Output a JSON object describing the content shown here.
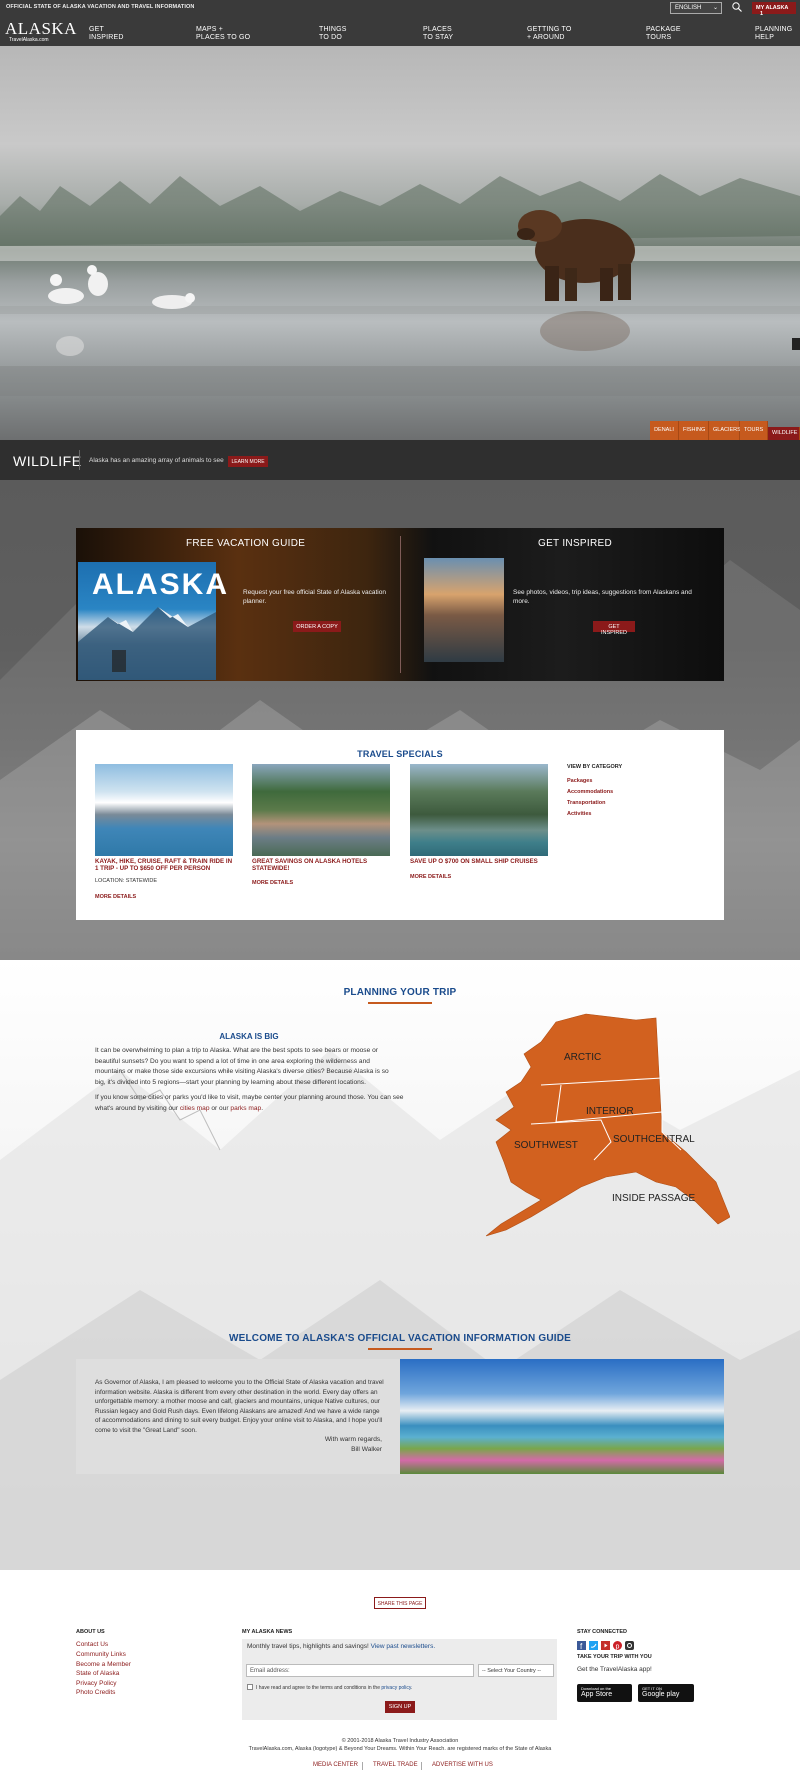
{
  "header": {
    "official_text": "OFFICIAL STATE OF ALASKA VACATION AND TRAVEL INFORMATION",
    "language": "ENGLISH",
    "my_alaska": "MY ALASKA",
    "my_alaska_count": "1",
    "logo_main": "ALASKA",
    "logo_sub": "TravelAlaska.com",
    "nav": [
      {
        "line1": "GET",
        "line2": "INSPIRED"
      },
      {
        "line1": "MAPS +",
        "line2": "PLACES TO GO"
      },
      {
        "line1": "THINGS",
        "line2": "TO DO"
      },
      {
        "line1": "PLACES",
        "line2": "TO STAY"
      },
      {
        "line1": "GETTING TO",
        "line2": "+ AROUND"
      },
      {
        "line1": "PACKAGE",
        "line2": "TOURS"
      },
      {
        "line1": "PLANNING",
        "line2": "HELP"
      }
    ]
  },
  "hero": {
    "tabs": [
      "DENALI",
      "FISHING",
      "GLACIERS",
      "TOURS",
      "WILDLIFE"
    ],
    "active_tab": "WILDLIFE",
    "caption_title": "WILDLIFE",
    "caption_text": "Alaska has an amazing array of animals to see",
    "learn_more": "LEARN MORE"
  },
  "promo": {
    "guide_title": "FREE VACATION GUIDE",
    "guide_cover_title": "ALASKA",
    "guide_text": "Request your free official State of Alaska vacation planner.",
    "guide_button": "ORDER A COPY",
    "inspire_title": "GET INSPIRED",
    "inspire_text": "See photos, videos, trip ideas, suggestions from Alaskans and more.",
    "inspire_button": "GET INSPIRED"
  },
  "specials": {
    "title": "TRAVEL SPECIALS",
    "items": [
      {
        "name": "KAYAK, HIKE, CRUISE, RAFT & TRAIN RIDE IN 1 TRIP - UP TO $650 OFF PER PERSON",
        "location": "LOCATION: STATEWIDE",
        "more": "MORE DETAILS"
      },
      {
        "name": "GREAT SAVINGS ON ALASKA HOTELS STATEWIDE!",
        "location": "",
        "more": "MORE DETAILS"
      },
      {
        "name": "SAVE UP O $700 ON SMALL SHIP CRUISES",
        "location": "",
        "more": "MORE DETAILS"
      }
    ],
    "category_head": "VIEW BY CATEGORY",
    "categories": [
      "Packages",
      "Accommodations",
      "Transportation",
      "Activities"
    ]
  },
  "planning": {
    "title": "PLANNING YOUR TRIP",
    "big_title": "ALASKA IS BIG",
    "para1": "It can be overwhelming to plan a trip to Alaska. What are the best spots to see bears or moose or beautiful sunsets? Do you want to spend a lot of time in one area exploring the wilderness and mountains or make those side excursions while visiting Alaska's diverse cities? Because Alaska is so big, it's divided into 5 regions—start your planning by learning about these different locations.",
    "para2_a": "If you know some cities or parks you'd like to visit, maybe center your planning around those. You can see what's around by visiting our ",
    "cities_map": "cities map",
    "para2_b": " or our ",
    "parks_map": "parks map",
    "para2_c": ".",
    "regions": [
      "ARCTIC",
      "INTERIOR",
      "SOUTHWEST",
      "SOUTHCENTRAL",
      "INSIDE PASSAGE"
    ],
    "map_color": "#d2611f"
  },
  "welcome": {
    "title": "WELCOME TO ALASKA'S OFFICIAL VACATION INFORMATION GUIDE",
    "text": "As Governor of Alaska, I am pleased to welcome you to the Official State of Alaska vacation and travel information website. Alaska is different from every other destination in the world. Every day offers an unforgettable memory: a mother moose and calf, glaciers and mountains, unique Native cultures, our Russian legacy and Gold Rush days. Even lifelong Alaskans are amazed! And we have a wide range of accommodations and dining to suit every budget. Enjoy your online visit to Alaska, and I hope you'll come to visit the \"Great Land\" soon.",
    "regards": "With warm regards,",
    "signature": "Bill Walker"
  },
  "footer": {
    "share": "SHARE THIS PAGE",
    "about_head": "ABOUT US",
    "about_links": [
      "Contact Us",
      "Community Links",
      "Become a Member",
      "State of Alaska",
      "Privacy Policy",
      "Photo Credits"
    ],
    "news_head": "MY ALASKA NEWS",
    "news_text": "Monthly travel tips, highlights and savings! ",
    "news_link": "View past newsletters.",
    "email_placeholder": "Email address:",
    "country": "-- Select Your Country --",
    "agree_text": "I have read and agree to the terms and conditions in the ",
    "agree_link": "privacy policy",
    "agree_end": ".",
    "signup": "SIGN UP",
    "stay_head": "STAY CONNECTED",
    "take_head": "TAKE YOUR TRIP WITH YOU",
    "app_text": "Get the TravelAlaska app!",
    "appstore_small": "Download on the",
    "appstore": "App Store",
    "google_small": "GET IT ON",
    "google": "Google play",
    "copyright": "© 2001-2018 Alaska Travel Industry Association",
    "trademark": "TravelAlaska.com, Alaska (logotype) & Beyond Your Dreams. Within Your Reach. are registered marks of the State of Alaska",
    "bottom_links": [
      "MEDIA CENTER",
      "TRAVEL TRADE",
      "ADVERTISE WITH US"
    ]
  }
}
